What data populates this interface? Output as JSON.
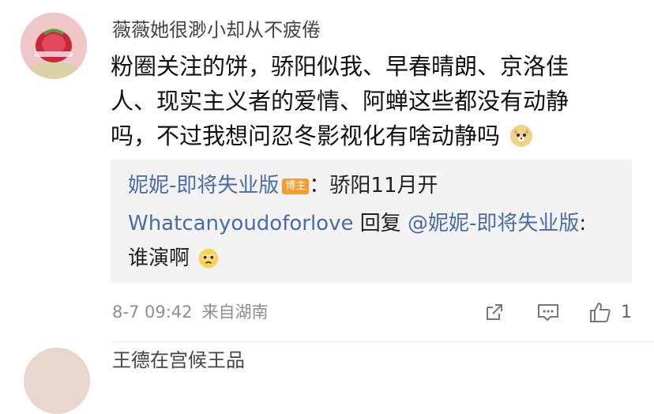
{
  "comment": {
    "username": "薇薇她很渺小却从不疲倦",
    "text": "粉圈关注的饼，骄阳似我、早春晴朗、京洛佳人、现实主义者的爱情、阿蝉这些都没有动静吗，不过我想问忍冬影视化有啥动静吗",
    "emoji": "doge-emoji",
    "time": "8-7 09:42",
    "location": "来自湖南"
  },
  "reply": {
    "author": "妮妮-即将失业版",
    "badge": "博主",
    "colon": "：",
    "content": "骄阳11月开",
    "reply_user": "Whatcanyoudoforlove",
    "reply_word": " 回复 ",
    "mention": "@妮妮-即将失业版",
    "reply_colon": ":",
    "reply_content": "谁演啊",
    "reply_emoji": "pleading-face-emoji"
  },
  "actions": {
    "like_count": "1"
  },
  "next_comment": {
    "username": "王德在宫候王品"
  },
  "colors": {
    "link": "#4a6ba8",
    "badge": "#f39c32",
    "reply_bg": "#f3f3f3",
    "meta": "#8e8e8e"
  }
}
